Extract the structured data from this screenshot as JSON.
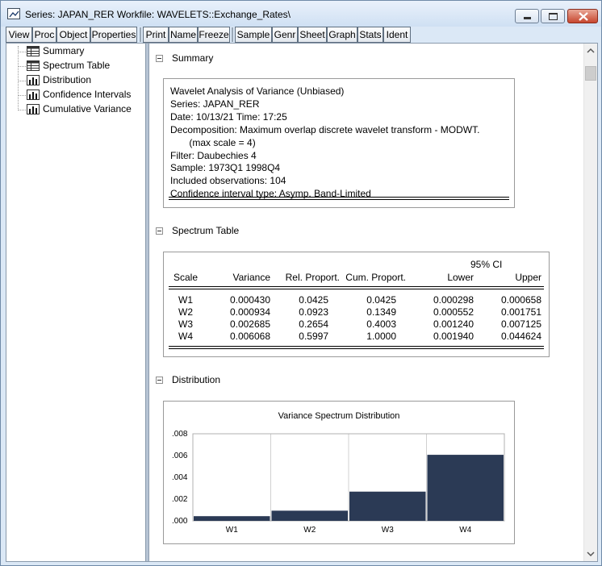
{
  "window": {
    "title": "Series: JAPAN_RER   Workfile: WAVELETS::Exchange_Rates\\"
  },
  "toolbar": {
    "buttons": [
      "View",
      "Proc",
      "Object",
      "Properties",
      "Print",
      "Name",
      "Freeze",
      "Sample",
      "Genr",
      "Sheet",
      "Graph",
      "Stats",
      "Ident"
    ]
  },
  "tree": {
    "items": [
      {
        "label": "Summary",
        "icon": "table-icon"
      },
      {
        "label": "Spectrum Table",
        "icon": "table-icon"
      },
      {
        "label": "Distribution",
        "icon": "bar-chart-icon"
      },
      {
        "label": "Confidence Intervals",
        "icon": "bar-chart-icon"
      },
      {
        "label": "Cumulative Variance",
        "icon": "bar-chart-icon"
      }
    ]
  },
  "summary": {
    "heading": "Summary",
    "lines": [
      "Wavelet Analysis of Variance (Unbiased)",
      "Series: JAPAN_RER",
      "Date: 10/13/21   Time: 17:25",
      "Decomposition: Maximum overlap discrete wavelet transform - MODWT.",
      "       (max scale = 4)",
      "Filter: Daubechies 4",
      "Sample: 1973Q1 1998Q4",
      "Included observations: 104",
      "Confidence interval type: Asymp. Band-Limited"
    ]
  },
  "spectrum": {
    "heading": "Spectrum Table",
    "ci_header": "95% CI",
    "columns": [
      "Scale",
      "Variance",
      "Rel. Proport.",
      "Cum. Proport.",
      "Lower",
      "Upper"
    ],
    "rows": [
      [
        "W1",
        "0.000430",
        "0.0425",
        "0.0425",
        "0.000298",
        "0.000658"
      ],
      [
        "W2",
        "0.000934",
        "0.0923",
        "0.1349",
        "0.000552",
        "0.001751"
      ],
      [
        "W3",
        "0.002685",
        "0.2654",
        "0.4003",
        "0.001240",
        "0.007125"
      ],
      [
        "W4",
        "0.006068",
        "0.5997",
        "1.0000",
        "0.001940",
        "0.044624"
      ]
    ]
  },
  "distribution": {
    "heading": "Distribution"
  },
  "chart_data": {
    "type": "bar",
    "title": "Variance Spectrum Distribution",
    "categories": [
      "W1",
      "W2",
      "W3",
      "W4"
    ],
    "values": [
      0.00043,
      0.000934,
      0.002685,
      0.006068
    ],
    "ylim": [
      0,
      0.008
    ],
    "yticks": [
      ".000",
      ".002",
      ".004",
      ".006",
      ".008"
    ],
    "grid": "vertical",
    "bar_color": "#2b3a55"
  }
}
